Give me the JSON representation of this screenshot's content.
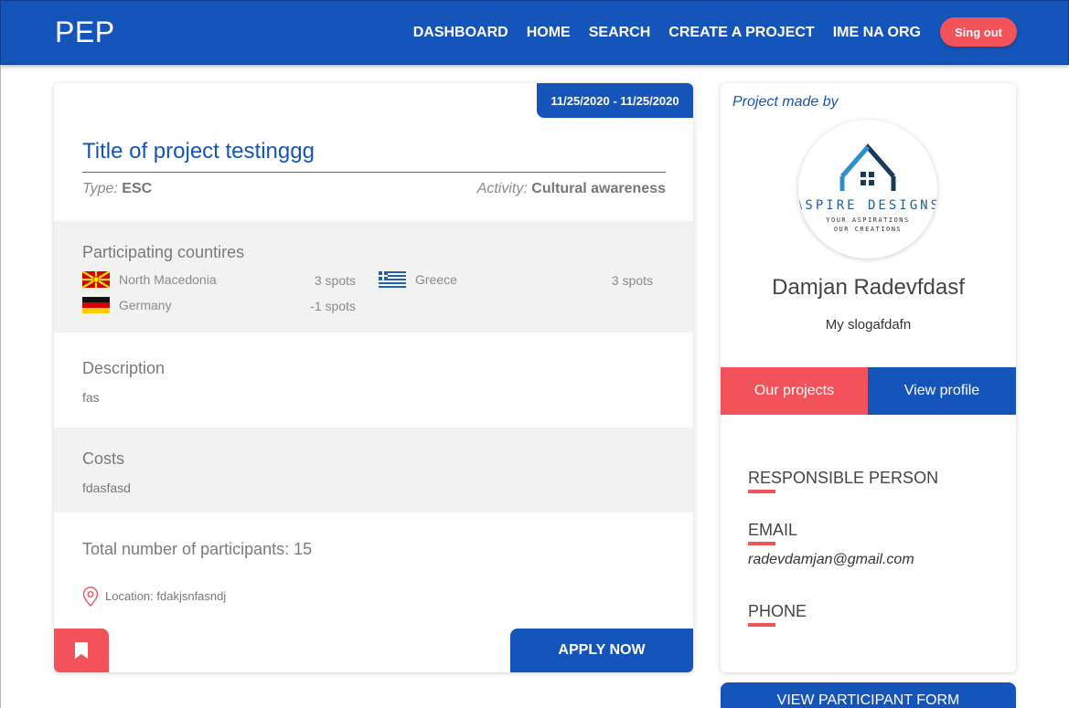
{
  "nav": {
    "brand": "PEP",
    "links": [
      "DASHBOARD",
      "HOME",
      "SEARCH",
      "CREATE A PROJECT",
      "IME NA ORG"
    ],
    "signout_label": "Sing out"
  },
  "colors": {
    "primary": "#1554b9",
    "accent": "#f2535a",
    "section_grey": "#f2f2f2"
  },
  "project": {
    "date_range": "11/25/2020 - 11/25/2020",
    "title": "Title of project testinggg",
    "type_key": "Type:",
    "type_val": "ESC",
    "activity_key": "Activity:",
    "activity_val": "Cultural awareness",
    "countries_heading": "Participating countires",
    "countries": [
      {
        "name": "North Macedonia",
        "spots": "3 spots",
        "flag": "north-macedonia-flag"
      },
      {
        "name": "Greece",
        "spots": "3 spots",
        "flag": "greece-flag"
      },
      {
        "name": "Germany",
        "spots": "-1 spots",
        "flag": "germany-flag"
      }
    ],
    "description_heading": "Description",
    "description": "fas",
    "costs_heading": "Costs",
    "costs": "fdasfasd",
    "participants": "Total number of participants: 15",
    "location": "Location: fdakjsnfasndj",
    "apply_label": "APPLY NOW",
    "bookmark_icon": "bookmark-icon",
    "location_icon": "map-pin-icon"
  },
  "organizer": {
    "made_by": "Project made by",
    "logo_title": "ASPIRE DESIGNS",
    "logo_tagline_1": "YOUR ASPIRATIONS",
    "logo_tagline_2": "OUR CREATIONS",
    "name": "Damjan Radevfdasf",
    "slogan": "My slogafdafn",
    "our_projects_label": "Our projects",
    "view_profile_label": "View profile",
    "responsible_heading": "RESPONSIBLE PERSON",
    "email_heading": "EMAIL",
    "email": "radevdamjan@gmail.com",
    "phone_heading": "PHONE"
  },
  "participant_form_label": "VIEW PARTICIPANT FORM"
}
